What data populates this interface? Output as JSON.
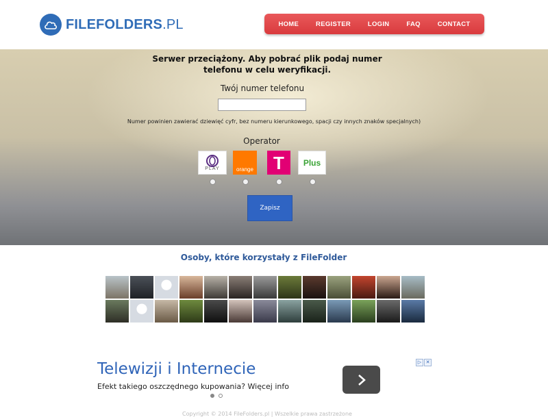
{
  "header": {
    "logo_bold": "FILEFOLDERS",
    "logo_suffix": ".PL",
    "brand_color": "#2f6cb7",
    "nav": [
      "HOME",
      "REGISTER",
      "LOGIN",
      "FAQ",
      "CONTACT"
    ],
    "nav_color": "#e04a4c"
  },
  "hero": {
    "title": "Serwer przeciążony. Aby pobrać plik podaj numer telefonu w celu weryfikacji.",
    "phone_label": "Twój numer telefonu",
    "phone_value": "",
    "hint": "Numer powinien zawierać dziewięć cyfr, bez numeru kierunkowego, spacji czy innych znaków specjalnych)",
    "operator_label": "Operator",
    "operators": [
      {
        "name": "play",
        "logo_text": "PLAY",
        "color": "#5a2d82"
      },
      {
        "name": "orange",
        "logo_text": "orange",
        "color": "#ff7900"
      },
      {
        "name": "t-mobile",
        "logo_text": "T",
        "color": "#e20074"
      },
      {
        "name": "plus",
        "logo_text": "Plus",
        "color": "#3aa335"
      }
    ],
    "save_label": "Zapisz",
    "save_color": "#2f64c3"
  },
  "users": {
    "title": "Osoby, które korzystały z FileFolder"
  },
  "ad": {
    "title": "Telewizji i Internecie",
    "subtitle": "Efekt takiego oszczędnego kupowania? Więcej info",
    "choices_icon": "ad-choices-icon"
  },
  "footer": {
    "text": "Copyright © 2014 FileFolders.pl | Wszelkie prawa zastrzeżone"
  }
}
